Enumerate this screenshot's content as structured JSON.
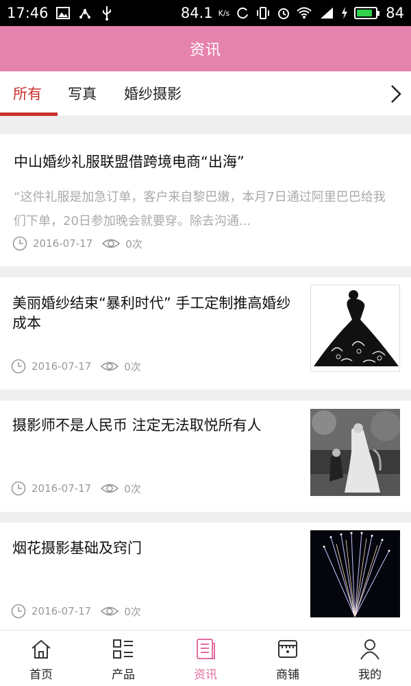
{
  "status_bar": {
    "time": "17:46",
    "net_speed": "84.1",
    "net_unit": "K/s",
    "signal": "4G",
    "battery": "84",
    "battery_level": 0.84,
    "battery_color": "#2fd24a"
  },
  "header": {
    "title": "资讯",
    "bg_color": "#e683ad"
  },
  "tabs": [
    {
      "label": "所有",
      "active": true
    },
    {
      "label": "写真",
      "active": false
    },
    {
      "label": "婚纱摄影",
      "active": false
    }
  ],
  "accent_color": "#c9302c",
  "articles": [
    {
      "title": "中山婚纱礼服联盟借跨境电商“出海”",
      "summary": "“这件礼服是加急订单，客户来自黎巴嫩，本月7日通过阿里巴巴给我们下单，20日参加晚会就要穿。除去沟通...",
      "date": "2016-07-17",
      "views": "0次"
    },
    {
      "title": "美丽婚纱结束“暴利时代” 手工定制推高婚纱成本",
      "date": "2016-07-17",
      "views": "0次",
      "thumb": "dress-silhouette"
    },
    {
      "title": "摄影师不是人民币 注定无法取悦所有人",
      "date": "2016-07-17",
      "views": "0次",
      "thumb": "wedding-photo-bw"
    },
    {
      "title": "烟花摄影基础及窍门",
      "date": "2016-07-17",
      "views": "0次",
      "thumb": "fireworks"
    }
  ],
  "bottom_nav": [
    {
      "label": "首页",
      "icon": "home-icon",
      "active": false
    },
    {
      "label": "产品",
      "icon": "product-grid-icon",
      "active": false
    },
    {
      "label": "资讯",
      "icon": "news-icon",
      "active": true
    },
    {
      "label": "商铺",
      "icon": "store-icon",
      "active": false
    },
    {
      "label": "我的",
      "icon": "user-icon",
      "active": false
    }
  ]
}
